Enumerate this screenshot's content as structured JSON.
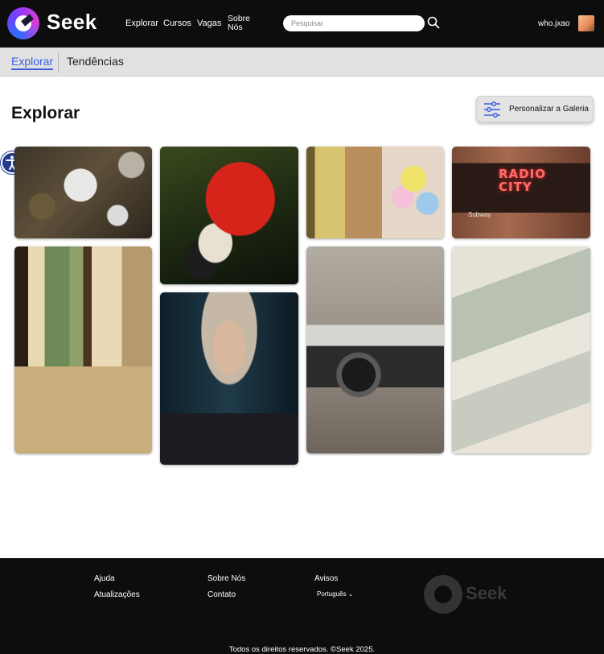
{
  "header": {
    "brand": "Seek",
    "nav": [
      "Explorar",
      "Cursos",
      "Vagas",
      "Sobre Nós"
    ],
    "search_placeholder": "Pesquisar",
    "username": "who.jxao"
  },
  "tabs": {
    "active": "Explorar",
    "other": "Tendências"
  },
  "main": {
    "title": "Explorar",
    "customize_label": "Personalizar a Galeria",
    "photo_texts": {
      "radio_city": "RADIO\nCITY",
      "subway": "Subway"
    }
  },
  "footer": {
    "links": [
      "Ajuda",
      "Atualizações",
      "Sobre Nós",
      "Contato",
      "Avisos"
    ],
    "language": "Português",
    "brand": "Seek",
    "copyright": "Todos os direitos reservados. ©Seek 2025."
  },
  "colors": {
    "accent": "#3b5fe0",
    "navbar": "#0d0d0d",
    "subbar": "#e1e1e1"
  },
  "icons": [
    "seek-logo-icon",
    "search-icon",
    "sliders-icon",
    "accessibility-icon",
    "chevron-down-icon"
  ]
}
